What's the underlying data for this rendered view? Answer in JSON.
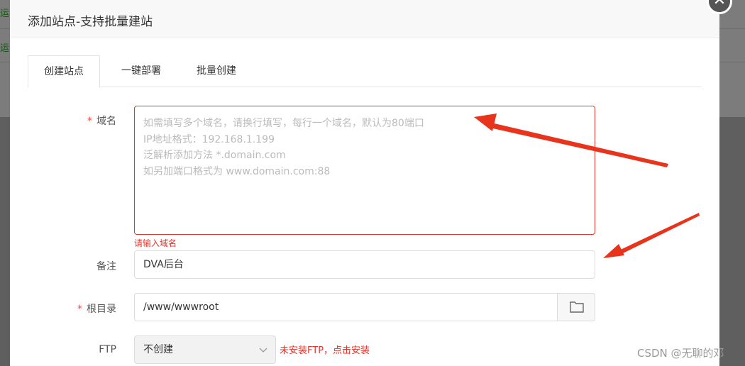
{
  "background": {
    "side_text_1": "运",
    "side_text_2": "运"
  },
  "modal": {
    "title": "添加站点-支持批量建站",
    "close_icon": "close-icon"
  },
  "tabs": [
    {
      "label": "创建站点",
      "active": true
    },
    {
      "label": "一键部署",
      "active": false
    },
    {
      "label": "批量创建",
      "active": false
    }
  ],
  "form": {
    "domain": {
      "required_mark": "*",
      "label": "域名",
      "placeholder_lines": [
        "如需填写多个域名，请换行填写，每行一个域名，默认为80端口",
        "IP地址格式：192.168.1.199",
        "泛解析添加方法 *.domain.com",
        "如另加端口格式为 www.domain.com:88"
      ],
      "error": "请输入域名"
    },
    "remark": {
      "label": "备注",
      "value": "DVA后台"
    },
    "root": {
      "required_mark": "*",
      "label": "根目录",
      "value": "/www/wwwroot",
      "folder_icon": "folder-icon"
    },
    "ftp": {
      "label": "FTP",
      "selected": "不创建",
      "note": "未安装FTP，点击安装"
    }
  },
  "annotations": {
    "arrow_color": "#e8341c"
  },
  "watermark": "CSDN @无聊的邓"
}
